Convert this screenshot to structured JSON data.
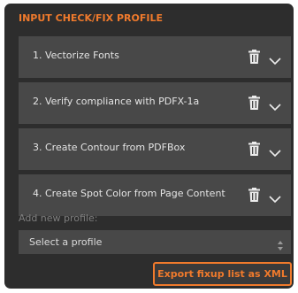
{
  "panel": {
    "title": "INPUT CHECK/FIX PROFILE",
    "accent_color": "#f07a2c",
    "background_color": "#2d2d2d"
  },
  "profiles": [
    {
      "label": "1. Vectorize Fonts",
      "delete_icon": "trash-icon",
      "expand_icon": "chevron-down-icon"
    },
    {
      "label": "2. Verify compliance with PDFX-1a",
      "delete_icon": "trash-icon",
      "expand_icon": "chevron-down-icon"
    },
    {
      "label": "3. Create Contour from PDFBox",
      "delete_icon": "trash-icon",
      "expand_icon": "chevron-down-icon"
    },
    {
      "label": "4. Create Spot Color from Page Content",
      "delete_icon": "trash-icon",
      "expand_icon": "chevron-down-icon"
    }
  ],
  "add_profile": {
    "label": "Add new profile:",
    "select_value": "Select a profile",
    "select_icon": "up-down-arrows-icon"
  },
  "export_button": {
    "label": "Export fixup list as XML"
  }
}
